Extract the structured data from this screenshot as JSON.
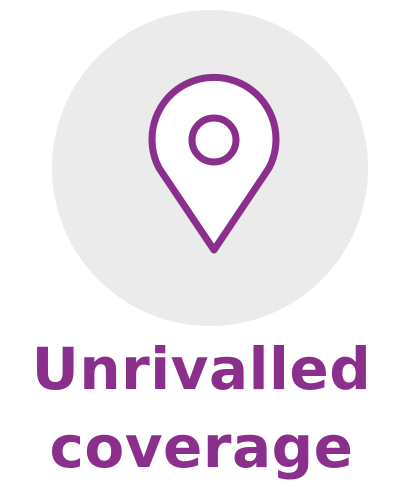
{
  "brand_color": "#8b2f8c",
  "circle_color": "#ebebeb",
  "icon": "location-pin-icon",
  "caption": {
    "line1": "Unrivalled",
    "line2": "coverage"
  }
}
